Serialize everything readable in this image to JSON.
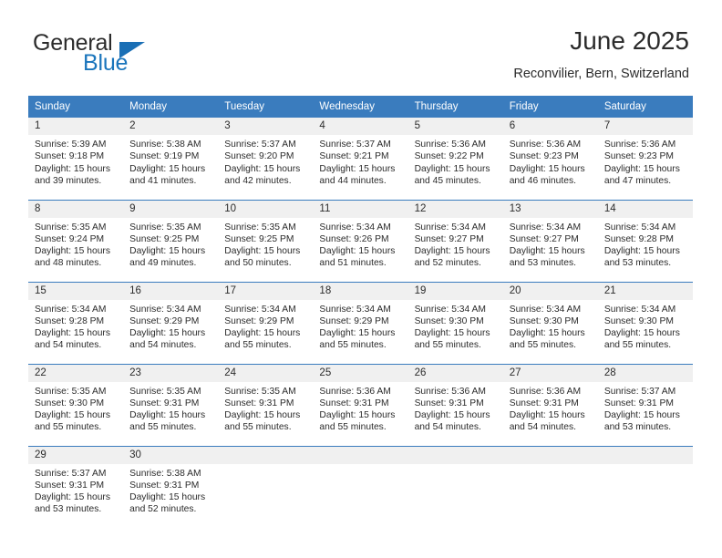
{
  "brand": {
    "name_top": "General",
    "name_bottom": "Blue",
    "accent_color": "#1a75bc",
    "triangle_icon": "triangle-icon"
  },
  "header": {
    "title": "June 2025",
    "subtitle": "Reconvilier, Bern, Switzerland"
  },
  "calendar": {
    "header_bg": "#3a7cbe",
    "daynum_bg": "#f0f0f0",
    "weekday_headers": [
      "Sunday",
      "Monday",
      "Tuesday",
      "Wednesday",
      "Thursday",
      "Friday",
      "Saturday"
    ],
    "weeks": [
      [
        {
          "day": "1",
          "sunrise": "Sunrise: 5:39 AM",
          "sunset": "Sunset: 9:18 PM",
          "daylight_line1": "Daylight: 15 hours",
          "daylight_line2": "and 39 minutes."
        },
        {
          "day": "2",
          "sunrise": "Sunrise: 5:38 AM",
          "sunset": "Sunset: 9:19 PM",
          "daylight_line1": "Daylight: 15 hours",
          "daylight_line2": "and 41 minutes."
        },
        {
          "day": "3",
          "sunrise": "Sunrise: 5:37 AM",
          "sunset": "Sunset: 9:20 PM",
          "daylight_line1": "Daylight: 15 hours",
          "daylight_line2": "and 42 minutes."
        },
        {
          "day": "4",
          "sunrise": "Sunrise: 5:37 AM",
          "sunset": "Sunset: 9:21 PM",
          "daylight_line1": "Daylight: 15 hours",
          "daylight_line2": "and 44 minutes."
        },
        {
          "day": "5",
          "sunrise": "Sunrise: 5:36 AM",
          "sunset": "Sunset: 9:22 PM",
          "daylight_line1": "Daylight: 15 hours",
          "daylight_line2": "and 45 minutes."
        },
        {
          "day": "6",
          "sunrise": "Sunrise: 5:36 AM",
          "sunset": "Sunset: 9:23 PM",
          "daylight_line1": "Daylight: 15 hours",
          "daylight_line2": "and 46 minutes."
        },
        {
          "day": "7",
          "sunrise": "Sunrise: 5:36 AM",
          "sunset": "Sunset: 9:23 PM",
          "daylight_line1": "Daylight: 15 hours",
          "daylight_line2": "and 47 minutes."
        }
      ],
      [
        {
          "day": "8",
          "sunrise": "Sunrise: 5:35 AM",
          "sunset": "Sunset: 9:24 PM",
          "daylight_line1": "Daylight: 15 hours",
          "daylight_line2": "and 48 minutes."
        },
        {
          "day": "9",
          "sunrise": "Sunrise: 5:35 AM",
          "sunset": "Sunset: 9:25 PM",
          "daylight_line1": "Daylight: 15 hours",
          "daylight_line2": "and 49 minutes."
        },
        {
          "day": "10",
          "sunrise": "Sunrise: 5:35 AM",
          "sunset": "Sunset: 9:25 PM",
          "daylight_line1": "Daylight: 15 hours",
          "daylight_line2": "and 50 minutes."
        },
        {
          "day": "11",
          "sunrise": "Sunrise: 5:34 AM",
          "sunset": "Sunset: 9:26 PM",
          "daylight_line1": "Daylight: 15 hours",
          "daylight_line2": "and 51 minutes."
        },
        {
          "day": "12",
          "sunrise": "Sunrise: 5:34 AM",
          "sunset": "Sunset: 9:27 PM",
          "daylight_line1": "Daylight: 15 hours",
          "daylight_line2": "and 52 minutes."
        },
        {
          "day": "13",
          "sunrise": "Sunrise: 5:34 AM",
          "sunset": "Sunset: 9:27 PM",
          "daylight_line1": "Daylight: 15 hours",
          "daylight_line2": "and 53 minutes."
        },
        {
          "day": "14",
          "sunrise": "Sunrise: 5:34 AM",
          "sunset": "Sunset: 9:28 PM",
          "daylight_line1": "Daylight: 15 hours",
          "daylight_line2": "and 53 minutes."
        }
      ],
      [
        {
          "day": "15",
          "sunrise": "Sunrise: 5:34 AM",
          "sunset": "Sunset: 9:28 PM",
          "daylight_line1": "Daylight: 15 hours",
          "daylight_line2": "and 54 minutes."
        },
        {
          "day": "16",
          "sunrise": "Sunrise: 5:34 AM",
          "sunset": "Sunset: 9:29 PM",
          "daylight_line1": "Daylight: 15 hours",
          "daylight_line2": "and 54 minutes."
        },
        {
          "day": "17",
          "sunrise": "Sunrise: 5:34 AM",
          "sunset": "Sunset: 9:29 PM",
          "daylight_line1": "Daylight: 15 hours",
          "daylight_line2": "and 55 minutes."
        },
        {
          "day": "18",
          "sunrise": "Sunrise: 5:34 AM",
          "sunset": "Sunset: 9:29 PM",
          "daylight_line1": "Daylight: 15 hours",
          "daylight_line2": "and 55 minutes."
        },
        {
          "day": "19",
          "sunrise": "Sunrise: 5:34 AM",
          "sunset": "Sunset: 9:30 PM",
          "daylight_line1": "Daylight: 15 hours",
          "daylight_line2": "and 55 minutes."
        },
        {
          "day": "20",
          "sunrise": "Sunrise: 5:34 AM",
          "sunset": "Sunset: 9:30 PM",
          "daylight_line1": "Daylight: 15 hours",
          "daylight_line2": "and 55 minutes."
        },
        {
          "day": "21",
          "sunrise": "Sunrise: 5:34 AM",
          "sunset": "Sunset: 9:30 PM",
          "daylight_line1": "Daylight: 15 hours",
          "daylight_line2": "and 55 minutes."
        }
      ],
      [
        {
          "day": "22",
          "sunrise": "Sunrise: 5:35 AM",
          "sunset": "Sunset: 9:30 PM",
          "daylight_line1": "Daylight: 15 hours",
          "daylight_line2": "and 55 minutes."
        },
        {
          "day": "23",
          "sunrise": "Sunrise: 5:35 AM",
          "sunset": "Sunset: 9:31 PM",
          "daylight_line1": "Daylight: 15 hours",
          "daylight_line2": "and 55 minutes."
        },
        {
          "day": "24",
          "sunrise": "Sunrise: 5:35 AM",
          "sunset": "Sunset: 9:31 PM",
          "daylight_line1": "Daylight: 15 hours",
          "daylight_line2": "and 55 minutes."
        },
        {
          "day": "25",
          "sunrise": "Sunrise: 5:36 AM",
          "sunset": "Sunset: 9:31 PM",
          "daylight_line1": "Daylight: 15 hours",
          "daylight_line2": "and 55 minutes."
        },
        {
          "day": "26",
          "sunrise": "Sunrise: 5:36 AM",
          "sunset": "Sunset: 9:31 PM",
          "daylight_line1": "Daylight: 15 hours",
          "daylight_line2": "and 54 minutes."
        },
        {
          "day": "27",
          "sunrise": "Sunrise: 5:36 AM",
          "sunset": "Sunset: 9:31 PM",
          "daylight_line1": "Daylight: 15 hours",
          "daylight_line2": "and 54 minutes."
        },
        {
          "day": "28",
          "sunrise": "Sunrise: 5:37 AM",
          "sunset": "Sunset: 9:31 PM",
          "daylight_line1": "Daylight: 15 hours",
          "daylight_line2": "and 53 minutes."
        }
      ],
      [
        {
          "day": "29",
          "sunrise": "Sunrise: 5:37 AM",
          "sunset": "Sunset: 9:31 PM",
          "daylight_line1": "Daylight: 15 hours",
          "daylight_line2": "and 53 minutes."
        },
        {
          "day": "30",
          "sunrise": "Sunrise: 5:38 AM",
          "sunset": "Sunset: 9:31 PM",
          "daylight_line1": "Daylight: 15 hours",
          "daylight_line2": "and 52 minutes."
        },
        {
          "day": "",
          "sunrise": "",
          "sunset": "",
          "daylight_line1": "",
          "daylight_line2": ""
        },
        {
          "day": "",
          "sunrise": "",
          "sunset": "",
          "daylight_line1": "",
          "daylight_line2": ""
        },
        {
          "day": "",
          "sunrise": "",
          "sunset": "",
          "daylight_line1": "",
          "daylight_line2": ""
        },
        {
          "day": "",
          "sunrise": "",
          "sunset": "",
          "daylight_line1": "",
          "daylight_line2": ""
        },
        {
          "day": "",
          "sunrise": "",
          "sunset": "",
          "daylight_line1": "",
          "daylight_line2": ""
        }
      ]
    ]
  }
}
